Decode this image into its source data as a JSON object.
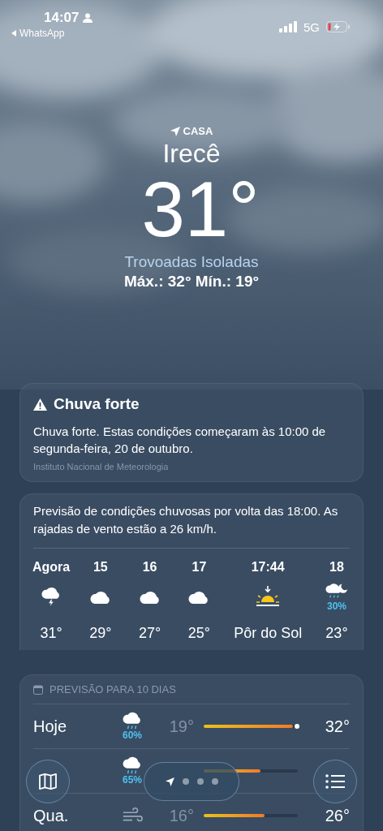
{
  "status_bar": {
    "time": "14:07",
    "back_app": "WhatsApp",
    "network": "5G"
  },
  "header": {
    "location_label": "CASA",
    "city": "Irecê",
    "temperature": "31°",
    "condition": "Trovoadas Isoladas",
    "high_low": "Máx.: 32°  Mín.: 19°"
  },
  "alert": {
    "title": "Chuva forte",
    "text": "Chuva forte. Estas condições começaram às 10:00 de segunda-feira, 20 de outubro.",
    "source": "Instituto Nacional de Meteorologia"
  },
  "hourly": {
    "summary": "Previsão de condições chuvosas por volta das 18:00. As rajadas de vento estão a 26 km/h.",
    "items": [
      {
        "time": "Agora",
        "kind": "thunder",
        "value": "31°"
      },
      {
        "time": "15",
        "kind": "cloud",
        "value": "29°"
      },
      {
        "time": "16",
        "kind": "cloud",
        "value": "27°"
      },
      {
        "time": "17",
        "kind": "cloud",
        "value": "25°"
      },
      {
        "time": "17:44",
        "kind": "sunset",
        "value": "Pôr do Sol"
      },
      {
        "time": "18",
        "kind": "rain-moon",
        "precip": "30%",
        "value": "23°"
      }
    ]
  },
  "daily": {
    "title": "PREVISÃO PARA 10 DIAS",
    "rows": [
      {
        "day": "Hoje",
        "kind": "rain",
        "precip": "60%",
        "low": "19°",
        "high": "32°",
        "level": 0.95,
        "now": true
      },
      {
        "kind": "rain",
        "precip": "65%",
        "level": 0.6,
        "now": false
      },
      {
        "day": "Qua.",
        "kind": "wind",
        "low": "16°",
        "high": "26°",
        "level": 0.65,
        "now": false
      }
    ]
  }
}
